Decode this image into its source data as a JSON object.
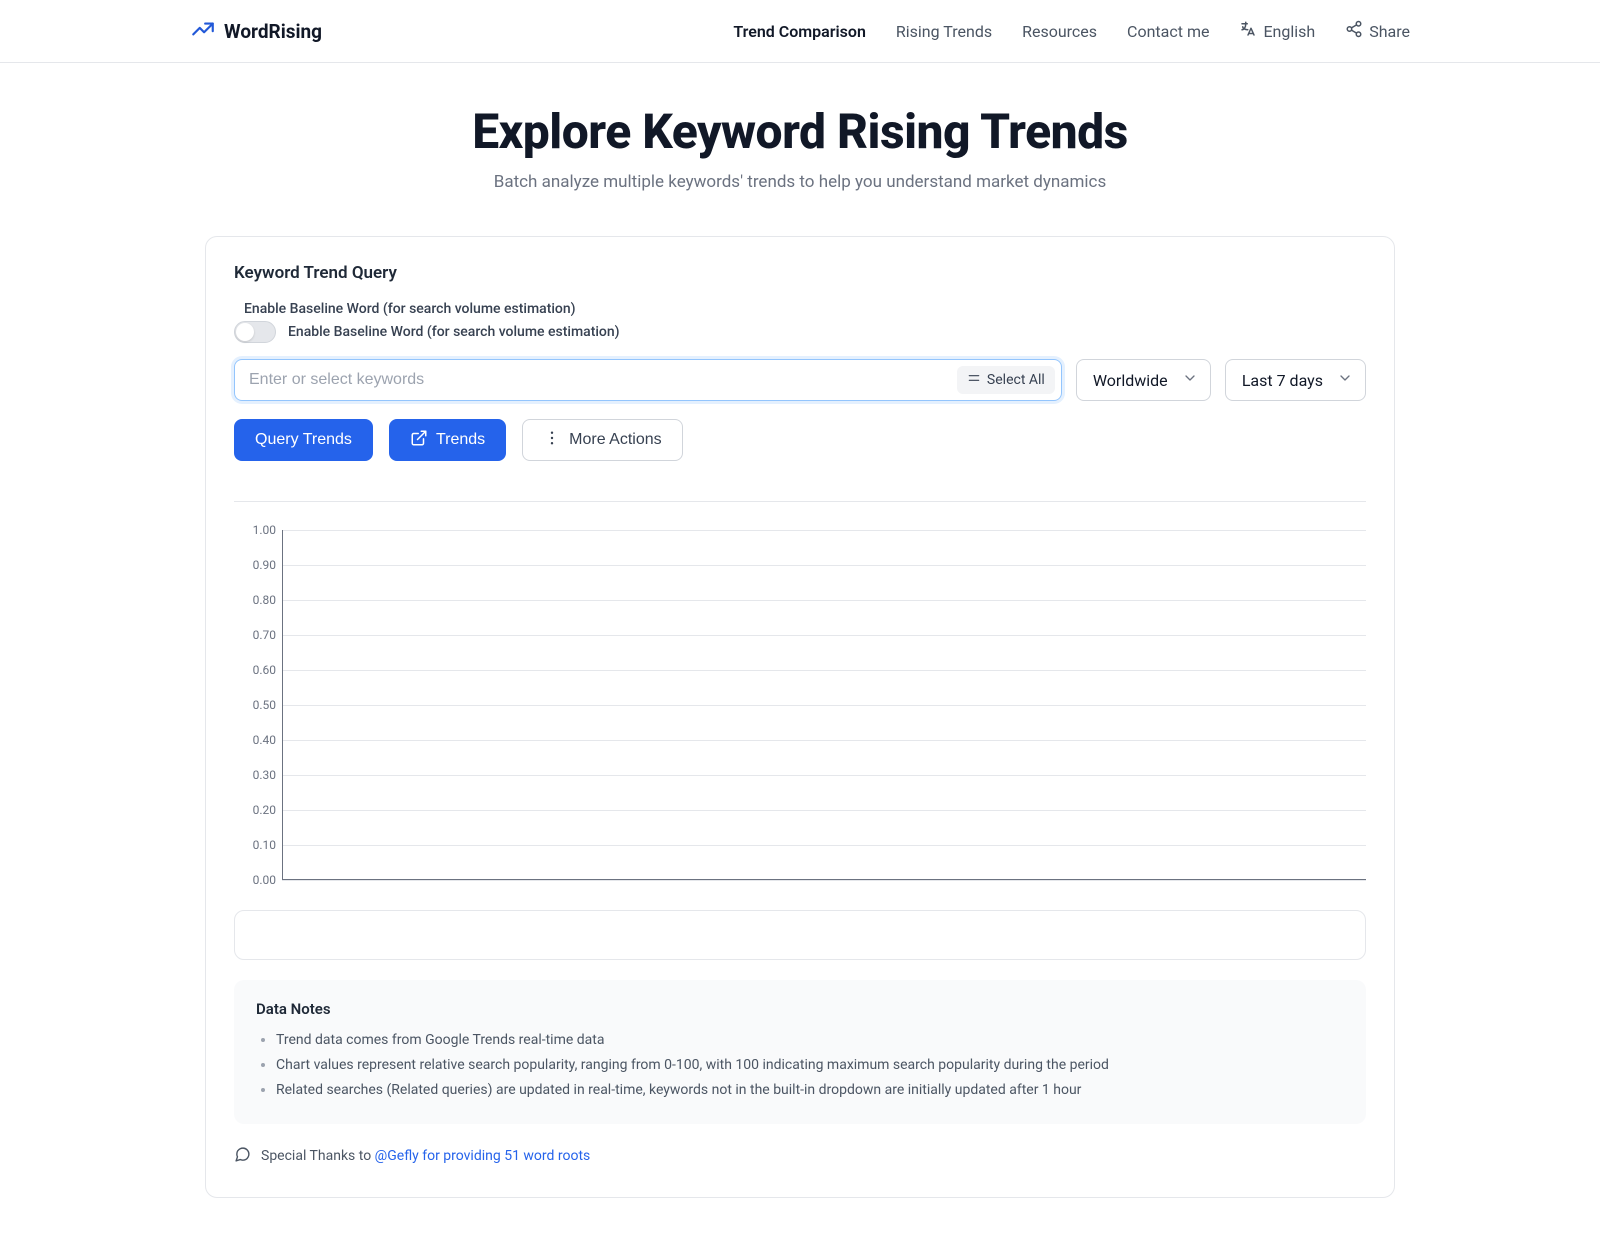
{
  "brand": {
    "name": "WordRising"
  },
  "nav": {
    "items": [
      {
        "label": "Trend Comparison",
        "active": true
      },
      {
        "label": "Rising Trends"
      },
      {
        "label": "Resources"
      },
      {
        "label": "Contact me"
      }
    ],
    "language": "English",
    "share": "Share"
  },
  "hero": {
    "title": "Explore Keyword Rising Trends",
    "subtitle": "Batch analyze multiple keywords' trends to help you understand market dynamics"
  },
  "query": {
    "section_title": "Keyword Trend Query",
    "baseline_label": "Enable Baseline Word (for search volume estimation)",
    "baseline_toggle_text": "Enable Baseline Word (for search volume estimation)",
    "keyword_placeholder": "Enter or select keywords",
    "select_all": "Select All",
    "region_value": "Worldwide",
    "period_value": "Last 7 days",
    "btn_query": "Query Trends",
    "btn_trends": "Trends",
    "btn_more": "More Actions"
  },
  "chart_data": {
    "type": "line",
    "series": [],
    "x": [],
    "ylabel": "",
    "xlabel": "",
    "ylim": [
      0,
      1
    ],
    "yticks": [
      "0.00",
      "0.10",
      "0.20",
      "0.30",
      "0.40",
      "0.50",
      "0.60",
      "0.70",
      "0.80",
      "0.90",
      "1.00"
    ]
  },
  "notes": {
    "title": "Data Notes",
    "items": [
      "Trend data comes from Google Trends real-time data",
      "Chart values represent relative search popularity, ranging from 0-100, with 100 indicating maximum search popularity during the period",
      "Related searches (Related queries) are updated in real-time, keywords not in the built-in dropdown are initially updated after 1 hour"
    ]
  },
  "thanks": {
    "prefix": "Special Thanks to ",
    "link_text": "@Gefly for providing 51 word roots"
  }
}
